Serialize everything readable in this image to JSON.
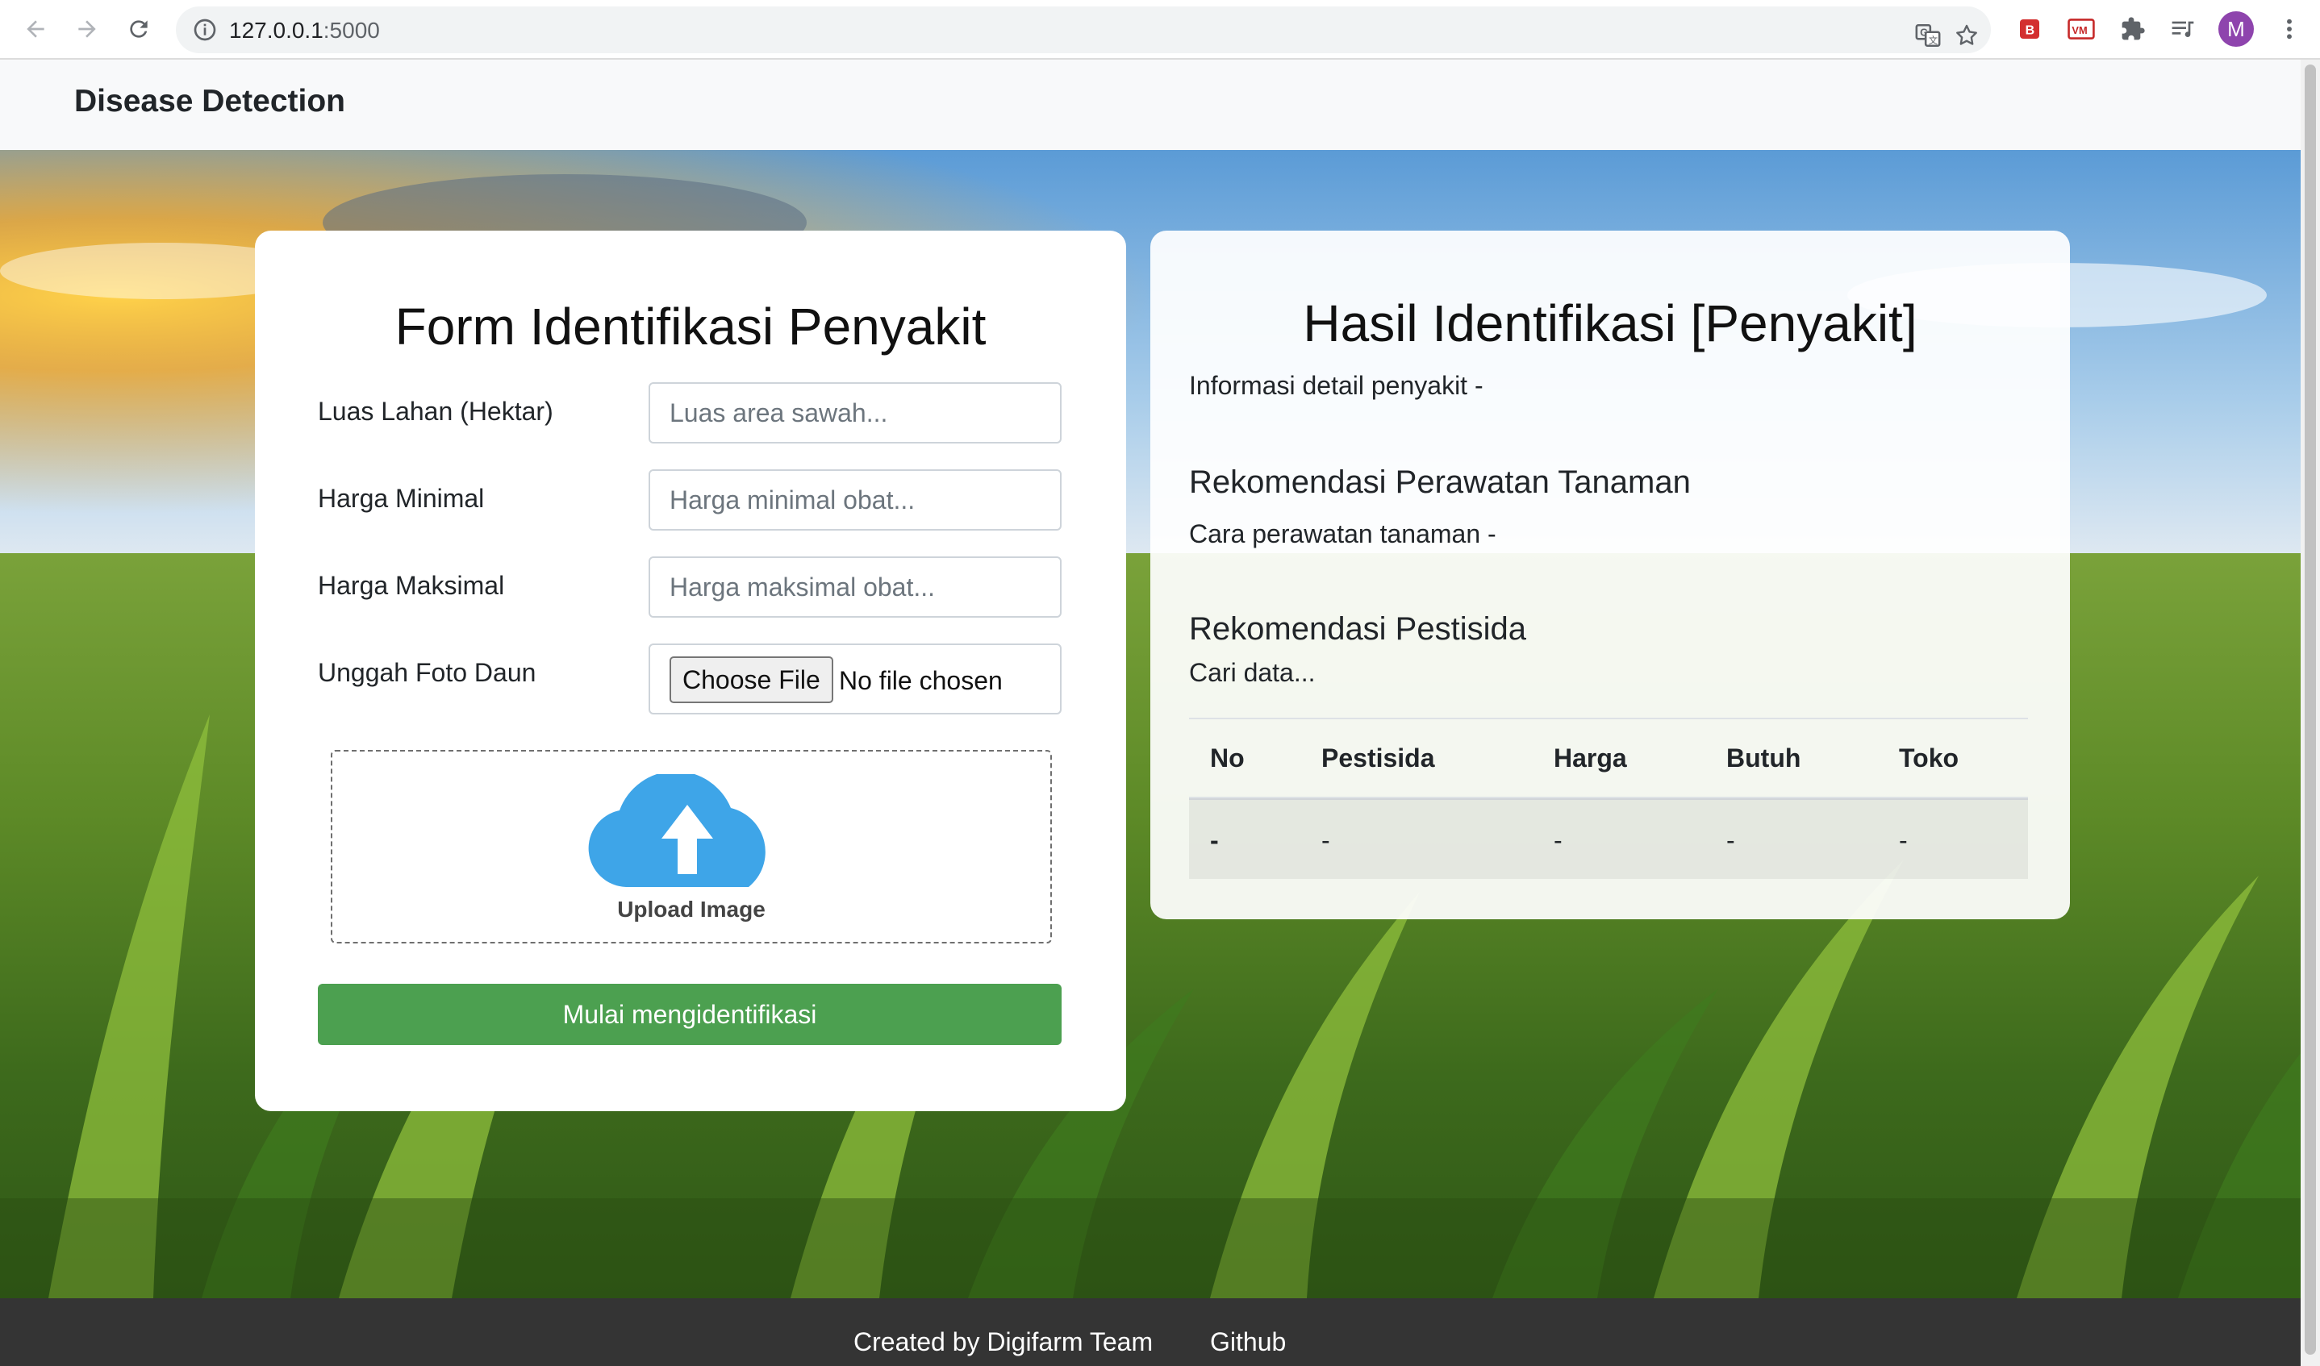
{
  "browser": {
    "url_host": "127.0.0.1",
    "url_port": ":5000",
    "icons": [
      "back-icon",
      "forward-icon",
      "reload-icon",
      "info-icon",
      "translate-icon",
      "star-icon",
      "extension-b-icon",
      "extension-vm-icon",
      "extensions-puzzle-icon",
      "reading-list-icon",
      "profile-avatar",
      "menu-kebab-icon"
    ],
    "profile_initial": "M"
  },
  "navbar": {
    "brand": "Disease Detection"
  },
  "form": {
    "title": "Form Identifikasi Penyakit",
    "fields": [
      {
        "label": "Luas Lahan (Hektar)",
        "placeholder": "Luas area sawah..."
      },
      {
        "label": "Harga Minimal",
        "placeholder": "Harga minimal obat..."
      },
      {
        "label": "Harga Maksimal",
        "placeholder": "Harga maksimal obat..."
      }
    ],
    "upload_field": {
      "label": "Unggah Foto Daun",
      "button": "Choose File",
      "status": "No file chosen"
    },
    "dropzone_label": "Upload Image",
    "submit_label": "Mulai mengidentifikasi"
  },
  "result": {
    "title": "Hasil Identifikasi [Penyakit]",
    "detail": "Informasi detail penyakit -",
    "care_heading": "Rekomendasi Perawatan Tanaman",
    "care_text": "Cara perawatan tanaman -",
    "pest_heading": "Rekomendasi Pestisida",
    "pest_status": "Cari data...",
    "table": {
      "headers": [
        "No",
        "Pestisida",
        "Harga",
        "Butuh",
        "Toko"
      ],
      "rows": [
        [
          "-",
          "-",
          "-",
          "-",
          "-"
        ]
      ]
    }
  },
  "footer": {
    "credit": "Created by Digifarm Team",
    "link": "Github"
  },
  "colors": {
    "primary_button": "#4ca050",
    "cloud_icon": "#3ea5e8",
    "footer_bg": "#343434",
    "navbar_bg": "#f8f9fa",
    "avatar_bg": "#8e44ad"
  }
}
